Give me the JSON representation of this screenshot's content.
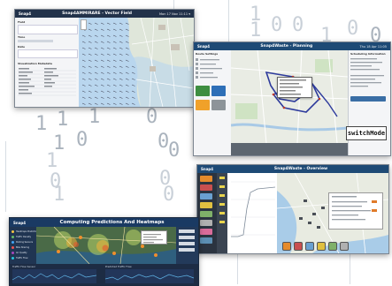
{
  "background_digits": [
    {
      "text": "1",
      "dark": false
    },
    {
      "text": "1",
      "dark": false
    },
    {
      "text": "0",
      "dark": false
    },
    {
      "text": "0",
      "dark": false
    },
    {
      "text": "1",
      "dark": false
    },
    {
      "text": "0",
      "dark": false
    },
    {
      "text": "0",
      "dark": true
    },
    {
      "text": "1",
      "dark": true
    },
    {
      "text": "1",
      "dark": true
    },
    {
      "text": "0",
      "dark": true
    },
    {
      "text": "1",
      "dark": true
    },
    {
      "text": "0",
      "dark": true
    },
    {
      "text": "0",
      "dark": true
    },
    {
      "text": "1",
      "dark": true
    },
    {
      "text": "0",
      "dark": true
    },
    {
      "text": "1",
      "dark": false
    },
    {
      "text": "0",
      "dark": false
    },
    {
      "text": "0",
      "dark": false
    },
    {
      "text": "1",
      "dark": false
    },
    {
      "text": "0",
      "dark": false
    }
  ],
  "screens": {
    "vector_field": {
      "logo": "Snap4",
      "title": "Snap4AMMIRARE - Vector Field",
      "meta": "Mon 17 Nov 11:11 ▾",
      "bar_color": "#22324a",
      "sections": [
        "Field",
        "Time",
        "Date",
        "Visualization Metadata"
      ],
      "slider_label": "4 h"
    },
    "planning": {
      "logo": "Snap4",
      "title": "Snap4Waste - Planning",
      "meta": "Thu 18 Apr 11:05",
      "bar_color": "#1e4a75",
      "left_header": "Route Settings",
      "right_header": "Scheduling Information",
      "switch_label": "switchMode",
      "legend_colors": [
        "#3e8e41",
        "#2e6fb7",
        "#f0a12a",
        "#8d9499"
      ]
    },
    "overview": {
      "logo": "Snap4",
      "title": "Snap4Waste - Overview",
      "meta": "",
      "bar_color": "#1e4a75",
      "bin_colors": [
        "#e58b2c",
        "#c94f4f",
        "#6aa0d0",
        "#e0c040",
        "#7fb069",
        "#b0b0b0",
        "#d96c9a",
        "#5c8fb3"
      ]
    },
    "predictions": {
      "logo": "Snap4",
      "title": "Computing Predictions And Heatmaps",
      "meta": "",
      "bar_color": "#1a3a63",
      "menu_items": [
        "Heatmaps Prediction",
        "Traffic Density",
        "Parking Sensors",
        "Bike Sharing",
        "Air Quality",
        "Traffic Flow"
      ],
      "bottom_left_title": "Traffic Flow Sensor",
      "bottom_right_title": "Predicted Traffic Flow"
    }
  }
}
